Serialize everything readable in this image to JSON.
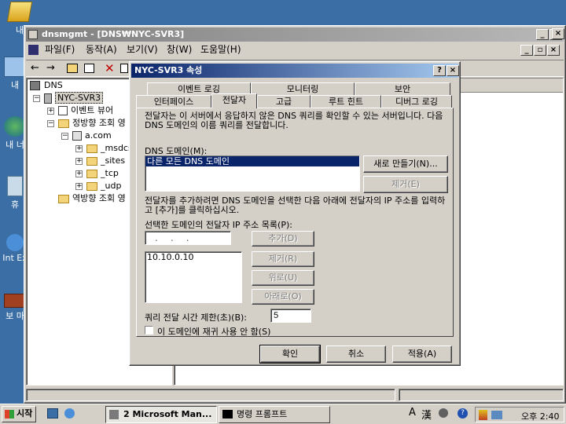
{
  "desktop": {
    "icons": [
      {
        "label": "내",
        "icon": "my-documents-icon"
      },
      {
        "label": "내",
        "icon": "my-computer-icon"
      },
      {
        "label": "내 너",
        "icon": "network-icon"
      },
      {
        "label": "휴",
        "icon": "recycle-bin-icon"
      },
      {
        "label": "Int Ex",
        "icon": "internet-explorer-icon"
      },
      {
        "label": "보 마",
        "icon": "briefcase-icon"
      }
    ]
  },
  "main_window": {
    "title": "dnsmgmt - [DNS₩NYC-SVR3]",
    "menu": [
      "파일(F)",
      "동작(A)",
      "보기(V)",
      "창(W)",
      "도움말(H)"
    ],
    "tree": {
      "root": "DNS",
      "server": "NYC-SVR3",
      "event_viewer": "이벤트 뷰어",
      "forward_zones": "정방향 조회 영",
      "zone": "a.com",
      "subfolders": [
        "_msdcs",
        "_sites",
        "_tcp",
        "_udp"
      ],
      "reverse_zones": "역방향 조회 영"
    }
  },
  "dialog": {
    "title": "NYC-SVR3 속성",
    "tabs_row1": [
      "이벤트 로깅",
      "모니터링",
      "보안"
    ],
    "tabs_row2": [
      "인터페이스",
      "전달자",
      "고급",
      "루트 힌트",
      "디버그 로깅"
    ],
    "description": "전달자는 이 서버에서 응답하지 않은 DNS 쿼리를 확인할 수 있는 서버입니다. 다음 DNS 도메인의 이름 쿼리를 전달합니다.",
    "domain_label": "DNS 도메인(M):",
    "domain_list": [
      "다른 모든 DNS 도메인"
    ],
    "new_button": "새로 만들기(N)...",
    "remove_button": "제거(E)",
    "add_hint": "전달자를 추가하려면 DNS 도메인을 선택한 다음 아래에 전달자의 IP 주소를 입력하고 [추가]를 클릭하십시오.",
    "ip_list_label": "선택한 도메인의 전달자 IP 주소 목록(P):",
    "ip_input_placeholder": " .  .  .",
    "ip_add_button": "추가(D)",
    "ip_remove_button": "제거(R)",
    "ip_up_button": "위로(U)",
    "ip_down_button": "아래로(O)",
    "ip_list": [
      "10.10.0.10"
    ],
    "timeout_label": "쿼리 전달 시간 제한(초)(B):",
    "timeout_value": "5",
    "no_recursion_label": "이 도메인에 재귀 사용 안 함(S)",
    "ok_button": "확인",
    "cancel_button": "취소",
    "apply_button": "적용(A)"
  },
  "taskbar": {
    "start": "시작",
    "tasks": [
      "2 Microsoft Man...",
      "명령 프롬프트"
    ],
    "ime": [
      "A",
      "漢"
    ],
    "clock": "오후 2:40"
  }
}
